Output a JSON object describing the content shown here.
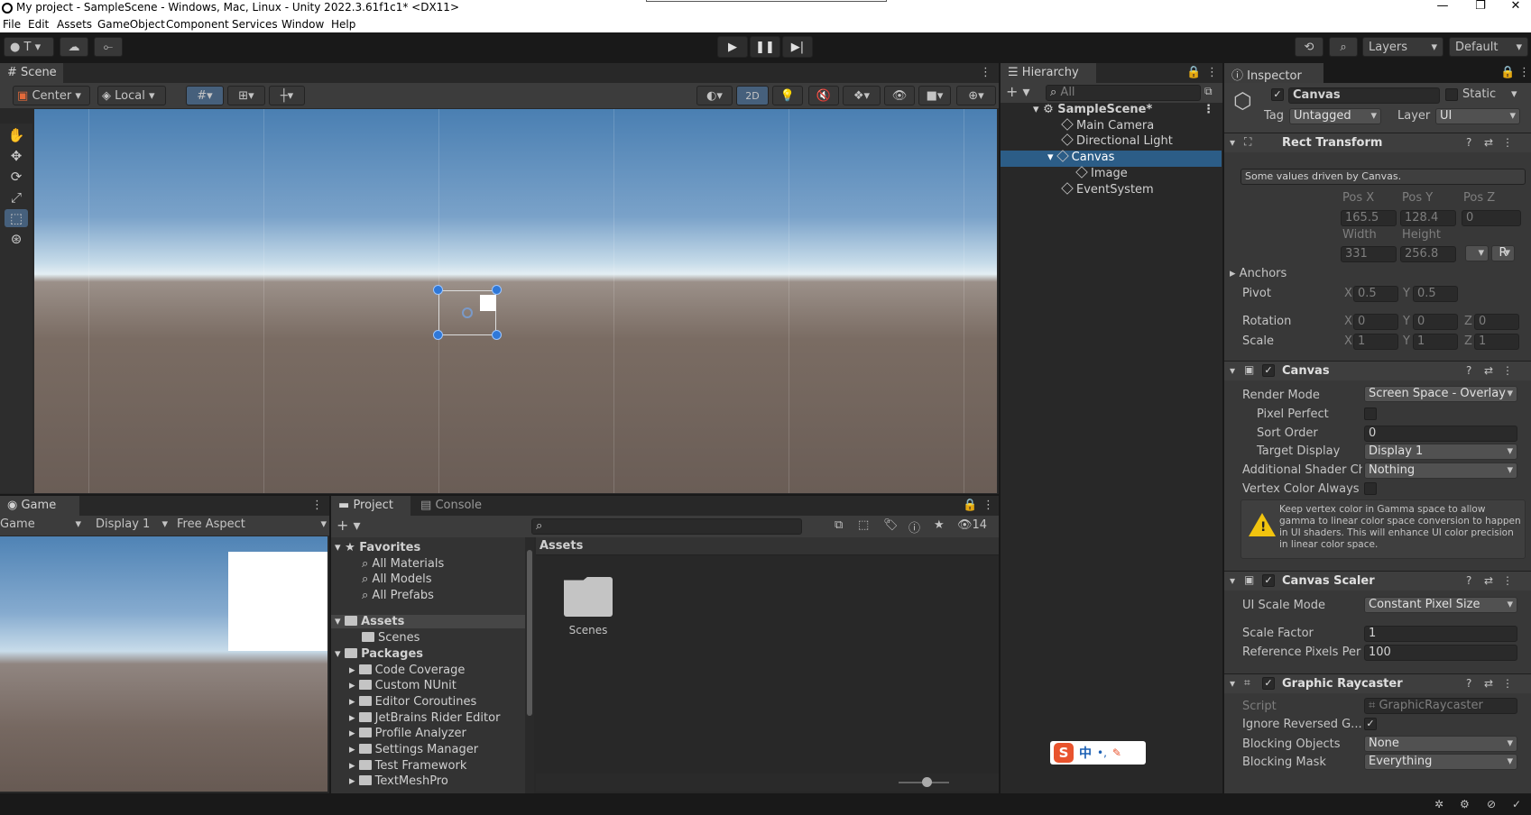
{
  "window": {
    "title": "My project - SampleScene - Windows, Mac, Linux - Unity 2022.3.61f1c1* <DX11>",
    "controls": [
      "—",
      "❐",
      "✕"
    ]
  },
  "menu": [
    "File",
    "Edit",
    "Assets",
    "GameObject",
    "Component",
    "Services",
    "Window",
    "Help"
  ],
  "toolbar": {
    "account": "T",
    "layers": "Layers",
    "layout": "Default"
  },
  "scene": {
    "tab": "Scene",
    "pivot": "Center",
    "space": "Local",
    "mode_2d": "2D"
  },
  "game": {
    "tab": "Game",
    "view": "Game",
    "display": "Display 1",
    "aspect": "Free Aspect"
  },
  "hierarchy": {
    "tab": "Hierarchy",
    "search_placeholder": "All",
    "scene": "SampleScene*",
    "items": [
      "Main Camera",
      "Directional Light",
      "Canvas",
      "Image",
      "EventSystem"
    ]
  },
  "project": {
    "tab": "Project",
    "console_tab": "Console",
    "hidden_count": "14",
    "favorites": "Favorites",
    "fav_items": [
      "All Materials",
      "All Models",
      "All Prefabs"
    ],
    "assets": "Assets",
    "asset_items": [
      "Scenes"
    ],
    "packages": "Packages",
    "package_items": [
      "Code Coverage",
      "Custom NUnit",
      "Editor Coroutines",
      "JetBrains Rider Editor",
      "Profile Analyzer",
      "Settings Manager",
      "Test Framework",
      "TextMeshPro"
    ],
    "breadcrumb": "Assets",
    "grid_item": "Scenes"
  },
  "inspector": {
    "tab": "Inspector",
    "object_name": "Canvas",
    "static": "Static",
    "tag_label": "Tag",
    "tag": "Untagged",
    "layer_label": "Layer",
    "layer": "UI",
    "rect": {
      "title": "Rect Transform",
      "info": "Some values driven by Canvas.",
      "posx_l": "Pos X",
      "posy_l": "Pos Y",
      "posz_l": "Pos Z",
      "posx": "165.5",
      "posy": "128.4",
      "posz": "0",
      "width_l": "Width",
      "height_l": "Height",
      "width": "331",
      "height": "256.8",
      "anchors": "Anchors",
      "pivot": "Pivot",
      "pivot_x": "0.5",
      "pivot_y": "0.5",
      "rotation": "Rotation",
      "rot_x": "0",
      "rot_y": "0",
      "rot_z": "0",
      "scale": "Scale",
      "scale_x": "1",
      "scale_y": "1",
      "scale_z": "1",
      "x": "X",
      "y": "Y",
      "z": "Z",
      "r_btn": "R"
    },
    "canvas": {
      "title": "Canvas",
      "render_mode_l": "Render Mode",
      "render_mode": "Screen Space - Overlay",
      "pixel_perfect_l": "Pixel Perfect",
      "sort_order_l": "Sort Order",
      "sort_order": "0",
      "target_display_l": "Target Display",
      "target_display": "Display 1",
      "shader_ch_l": "Additional Shader Ch",
      "shader_ch": "Nothing",
      "vertex_color_l": "Vertex Color Always",
      "warning": "Keep vertex color in Gamma space to allow gamma to linear color space conversion to happen in UI shaders. This will enhance UI color precision in linear color space."
    },
    "scaler": {
      "title": "Canvas Scaler",
      "ui_scale_l": "UI Scale Mode",
      "ui_scale": "Constant Pixel Size",
      "scale_factor_l": "Scale Factor",
      "scale_factor": "1",
      "ref_ppu_l": "Reference Pixels Per",
      "ref_ppu": "100"
    },
    "raycaster": {
      "title": "Graphic Raycaster",
      "script_l": "Script",
      "script": "GraphicRaycaster",
      "ignore_l": "Ignore Reversed G...",
      "blocking_obj_l": "Blocking Objects",
      "blocking_obj": "None",
      "blocking_mask_l": "Blocking Mask",
      "blocking_mask": "Everything"
    }
  },
  "ime": {
    "label": "中",
    "extra": "•,"
  },
  "colors": {
    "accent": "#2c5d87",
    "selected_row": "#2c5d87",
    "panel": "#383838",
    "header": "#3c3c3c",
    "warning": "#f1c40f"
  }
}
